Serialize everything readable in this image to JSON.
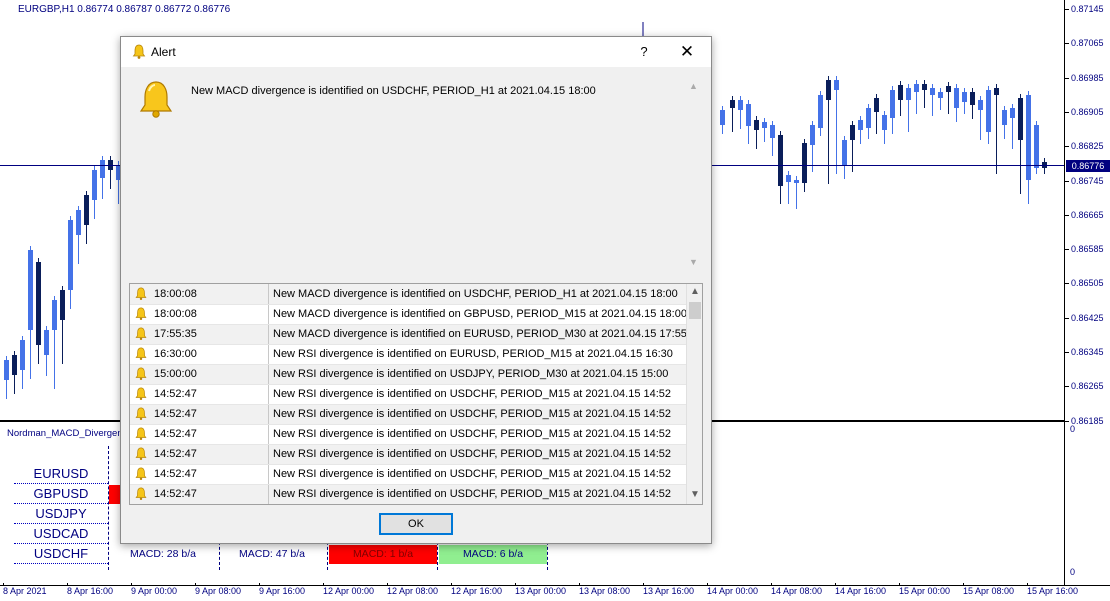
{
  "chart": {
    "symbol_info": "EURGBP,H1  0.86774 0.86787 0.86772 0.86776",
    "current_price": "0.86776",
    "price_labels": [
      "0.87145",
      "0.87065",
      "0.86985",
      "0.86905",
      "0.86825",
      "0.86745",
      "0.86665",
      "0.86585",
      "0.86505",
      "0.86425",
      "0.86345",
      "0.86265",
      "0.86185"
    ],
    "sub_axis_top": "0",
    "sub_axis_bottom": "0",
    "time_labels": [
      "8 Apr 2021",
      "8 Apr 16:00",
      "9 Apr 00:00",
      "9 Apr 08:00",
      "9 Apr 16:00",
      "12 Apr 00:00",
      "12 Apr 08:00",
      "12 Apr 16:00",
      "13 Apr 00:00",
      "13 Apr 08:00",
      "13 Apr 16:00",
      "14 Apr 00:00",
      "14 Apr 08:00",
      "14 Apr 16:00",
      "15 Apr 00:00",
      "15 Apr 08:00",
      "15 Apr 16:00"
    ],
    "colors": {
      "bull": "#4472e8",
      "bear": "#0a1e5a",
      "axis": "#000080"
    }
  },
  "indicator": {
    "title": "Nordman_MACD_Divergen",
    "symbols": [
      "EURUSD",
      "GBPUSD",
      "USDJPY",
      "USDCAD",
      "USDCHF"
    ],
    "usdchf_cells": [
      {
        "label": "MACD: 28 b/a",
        "bg": "",
        "color": "#000080"
      },
      {
        "label": "MACD: 47 b/a",
        "bg": "",
        "color": "#000080"
      },
      {
        "label": "MACD: 1 b/a",
        "bg": "#ff0000",
        "color": "#800000"
      },
      {
        "label": "MACD: 6 b/a",
        "bg": "#90ee90",
        "color": "#000080"
      }
    ]
  },
  "dialog": {
    "title": "Alert",
    "help": "?",
    "close": "✕",
    "message": "New MACD divergence is identified on USDCHF, PERIOD_H1 at 2021.04.15 18:00",
    "ok_label": "OK",
    "alerts": [
      {
        "time": "18:00:08",
        "message": "New MACD divergence is identified on USDCHF, PERIOD_H1 at 2021.04.15 18:00"
      },
      {
        "time": "18:00:08",
        "message": "New MACD divergence is identified on GBPUSD, PERIOD_M15 at 2021.04.15 18:00"
      },
      {
        "time": "17:55:35",
        "message": "New MACD divergence is identified on EURUSD, PERIOD_M30 at 2021.04.15 17:55"
      },
      {
        "time": "16:30:00",
        "message": "New RSI divergence is identified on EURUSD, PERIOD_M15 at 2021.04.15 16:30"
      },
      {
        "time": "15:00:00",
        "message": "New RSI divergence is identified on USDJPY, PERIOD_M30 at 2021.04.15 15:00"
      },
      {
        "time": "14:52:47",
        "message": "New RSI divergence is identified on USDCHF, PERIOD_M15 at 2021.04.15 14:52"
      },
      {
        "time": "14:52:47",
        "message": "New RSI divergence is identified on USDCHF, PERIOD_M15 at 2021.04.15 14:52"
      },
      {
        "time": "14:52:47",
        "message": "New RSI divergence is identified on USDCHF, PERIOD_M15 at 2021.04.15 14:52"
      },
      {
        "time": "14:52:47",
        "message": "New RSI divergence is identified on USDCHF, PERIOD_M15 at 2021.04.15 14:52"
      },
      {
        "time": "14:52:47",
        "message": "New RSI divergence is identified on USDCHF, PERIOD_M15 at 2021.04.15 14:52"
      },
      {
        "time": "14:52:47",
        "message": "New RSI divergence is identified on USDCHF, PERIOD_M15 at 2021.04.15 14:52"
      }
    ]
  }
}
